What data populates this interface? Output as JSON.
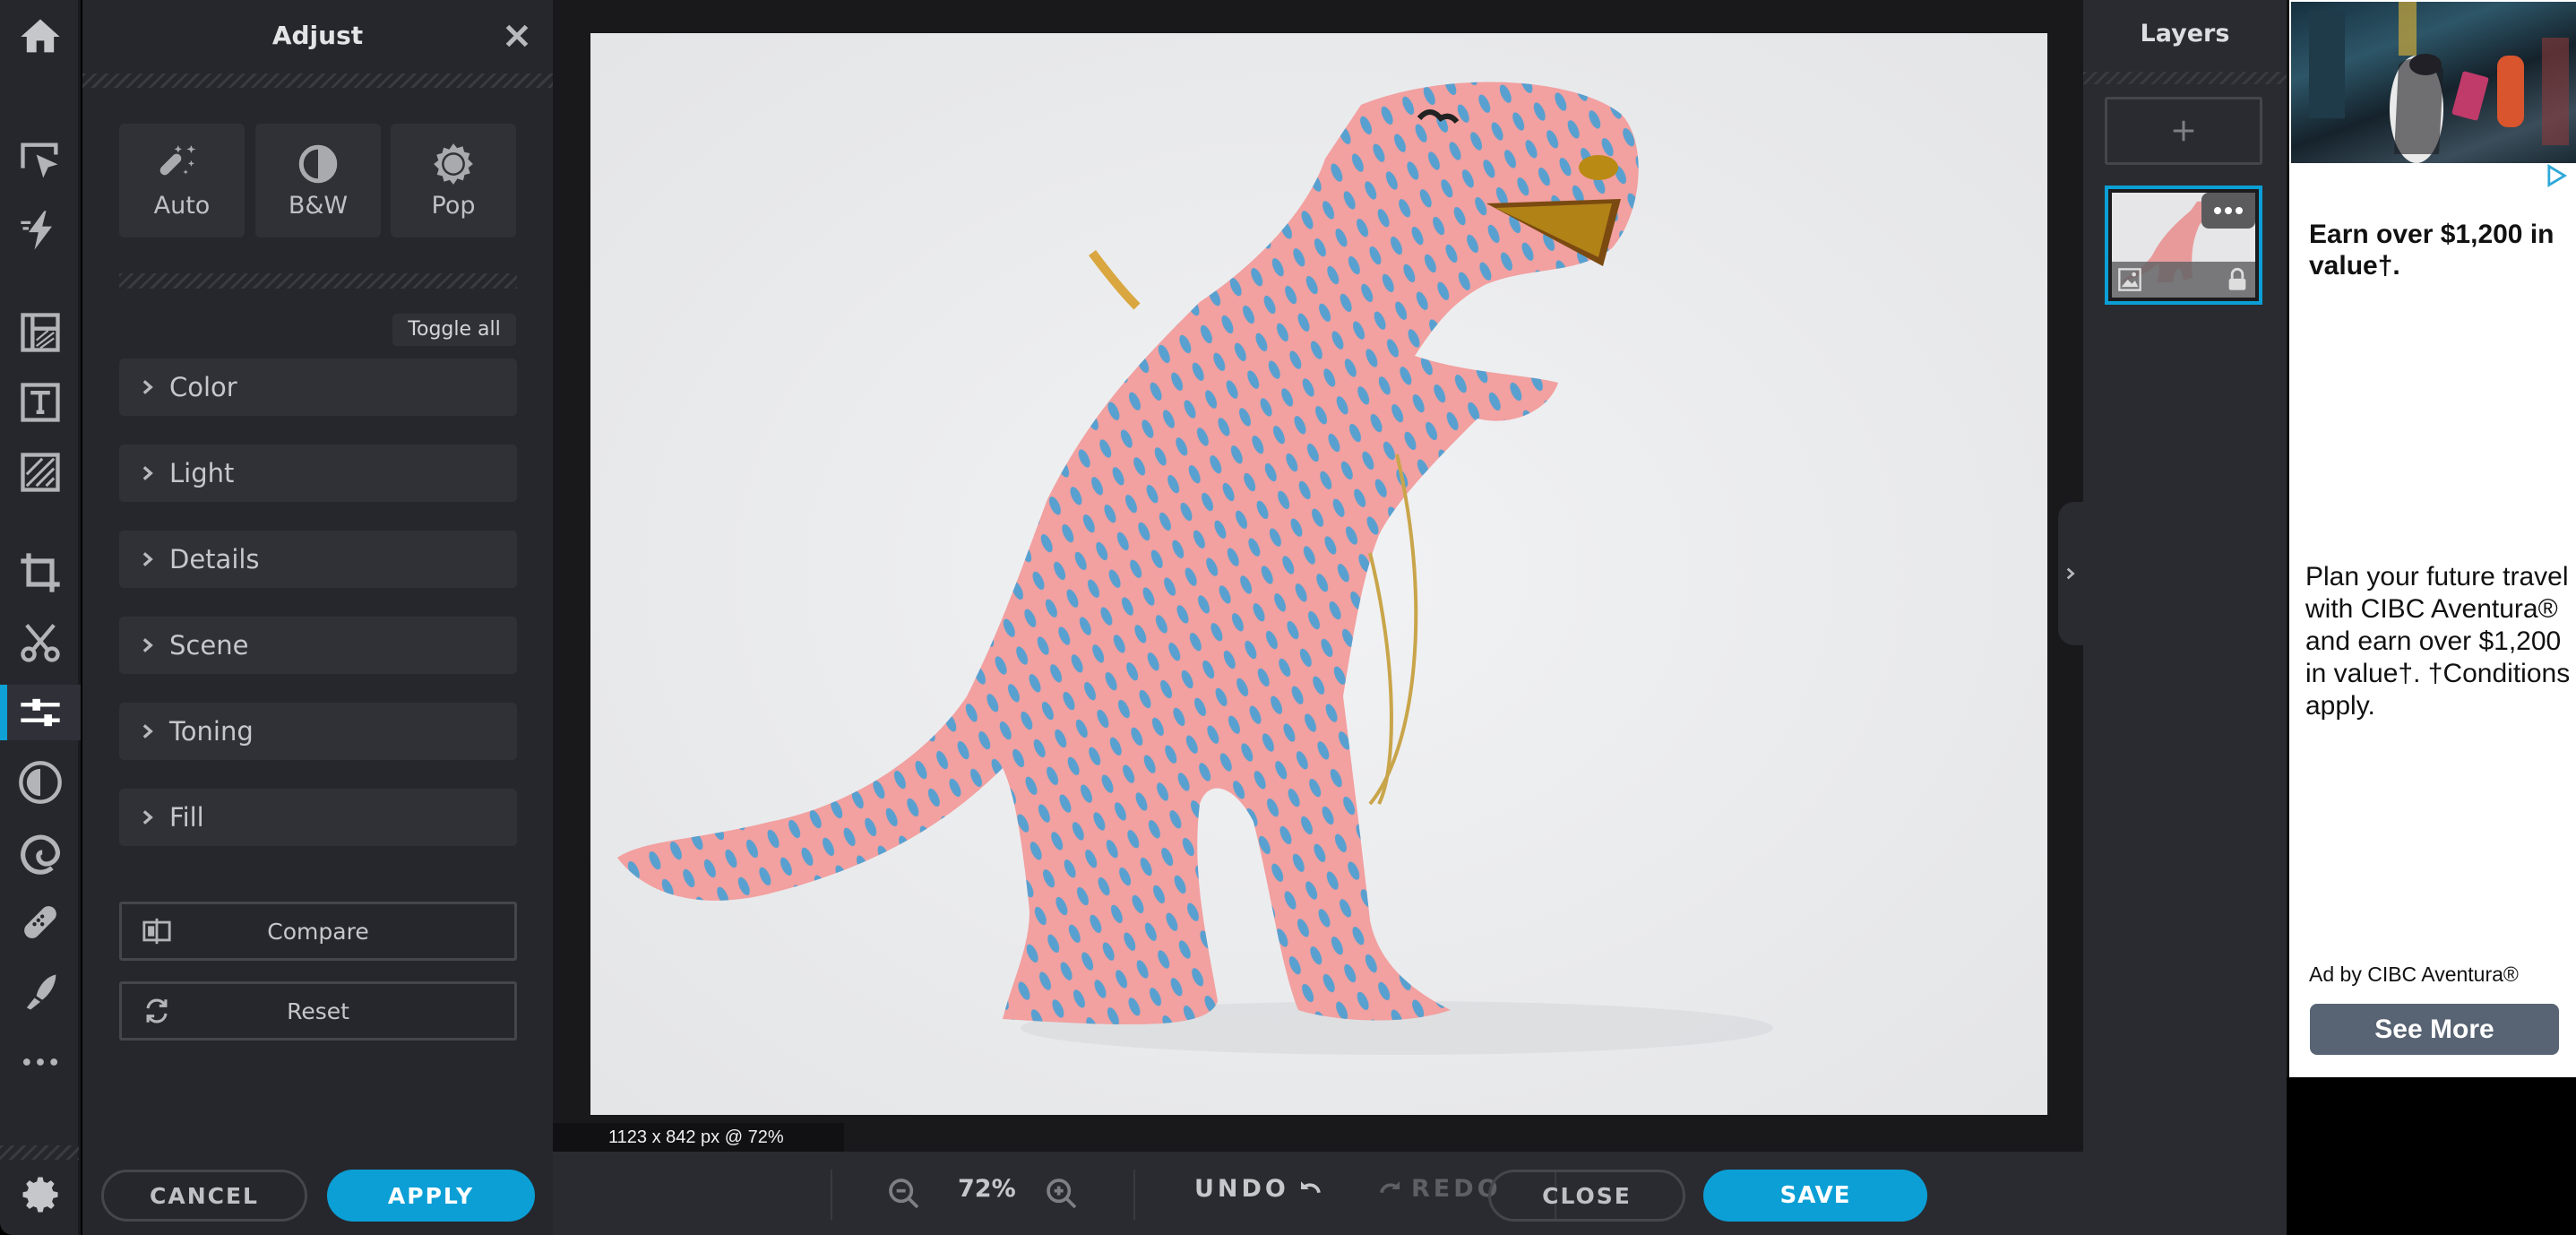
{
  "toolbar": {
    "items": [
      {
        "name": "home",
        "icon": "home-icon"
      },
      {
        "name": "select",
        "icon": "select-cursor-icon"
      },
      {
        "name": "quick-effects",
        "icon": "lightning-icon"
      },
      {
        "name": "layout",
        "icon": "layout-icon"
      },
      {
        "name": "text",
        "icon": "text-icon"
      },
      {
        "name": "texture",
        "icon": "hatch-icon"
      },
      {
        "name": "crop",
        "icon": "crop-icon"
      },
      {
        "name": "cutout",
        "icon": "scissors-icon"
      },
      {
        "name": "adjust",
        "icon": "sliders-icon",
        "active": true
      },
      {
        "name": "effects",
        "icon": "contrast-circle-icon"
      },
      {
        "name": "liquify",
        "icon": "spiral-icon"
      },
      {
        "name": "heal",
        "icon": "bandage-icon"
      },
      {
        "name": "draw",
        "icon": "brush-icon"
      },
      {
        "name": "more",
        "icon": "more-dots-icon"
      },
      {
        "name": "settings",
        "icon": "gear-icon"
      }
    ],
    "accent_color": "#0fa0d6"
  },
  "adjust_panel": {
    "title": "Adjust",
    "presets": [
      {
        "label": "Auto",
        "icon": "magic-wand-icon"
      },
      {
        "label": "B&W",
        "icon": "half-circle-icon"
      },
      {
        "label": "Pop",
        "icon": "sun-icon"
      }
    ],
    "toggle_all": "Toggle all",
    "sections": [
      "Color",
      "Light",
      "Details",
      "Scene",
      "Toning",
      "Fill"
    ],
    "compare": "Compare",
    "reset": "Reset",
    "cancel": "CANCEL",
    "apply": "APPLY"
  },
  "canvas": {
    "image_info": "1123 x 842 px @ 72%"
  },
  "bottom_bar": {
    "zoom": "72%",
    "undo": "UNDO",
    "redo": "REDO",
    "close": "CLOSE",
    "save": "SAVE",
    "accent_color": "#0b9fd6"
  },
  "layers": {
    "title": "Layers"
  },
  "ad": {
    "headline": "Earn over $1,200 in value†.",
    "body": "Plan your future travel with CIBC Aventura® and earn over $1,200 in value†. †Conditions apply.",
    "advertiser": "Ad by CIBC Aventura®",
    "cta": "See More"
  }
}
